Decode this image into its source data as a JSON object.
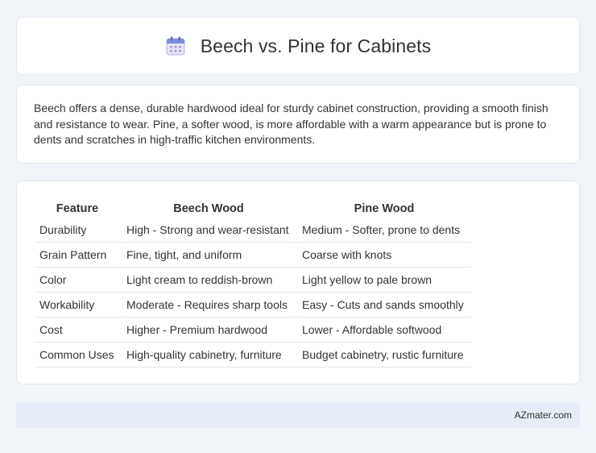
{
  "header": {
    "title": "Beech vs. Pine for Cabinets",
    "icon": "calendar-icon"
  },
  "description": {
    "text": "Beech offers a dense, durable hardwood ideal for sturdy cabinet construction, providing a smooth finish and resistance to wear. Pine, a softer wood, is more affordable with a warm appearance but is prone to dents and scratches in high-traffic kitchen environments."
  },
  "table": {
    "headers": [
      "Feature",
      "Beech Wood",
      "Pine Wood"
    ],
    "rows": [
      [
        "Durability",
        "High - Strong and wear-resistant",
        "Medium - Softer, prone to dents"
      ],
      [
        "Grain Pattern",
        "Fine, tight, and uniform",
        "Coarse with knots"
      ],
      [
        "Color",
        "Light cream to reddish-brown",
        "Light yellow to pale brown"
      ],
      [
        "Workability",
        "Moderate - Requires sharp tools",
        "Easy - Cuts and sands smoothly"
      ],
      [
        "Cost",
        "Higher - Premium hardwood",
        "Lower - Affordable softwood"
      ],
      [
        "Common Uses",
        "High-quality cabinetry, furniture",
        "Budget cabinetry, rustic furniture"
      ]
    ]
  },
  "footer": {
    "text": "AZmater.com"
  },
  "colors": {
    "page_bg": "#f1f4f9",
    "card_bg": "#ffffff",
    "footer_bg": "#e7edf8"
  }
}
